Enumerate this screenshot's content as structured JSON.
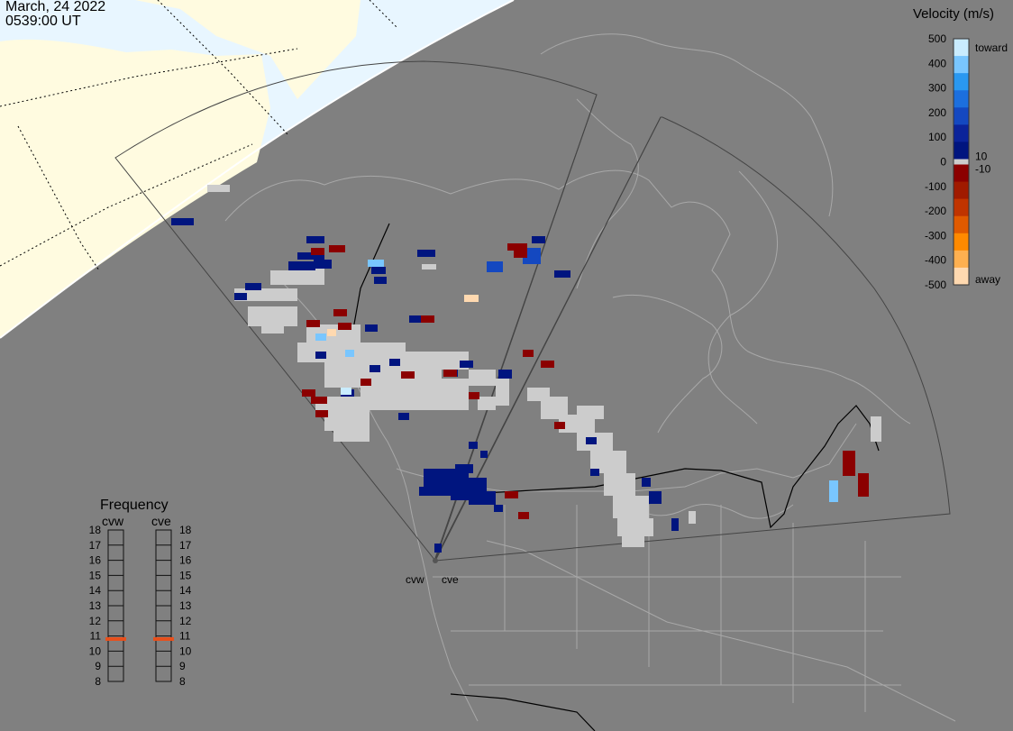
{
  "header": {
    "date": "March, 24 2022",
    "time": "0539:00 UT"
  },
  "velocity_legend": {
    "title": "Velocity (m/s)",
    "ticks": [
      "500",
      "400",
      "300",
      "200",
      "100",
      "0",
      "-100",
      "-200",
      "-300",
      "-400",
      "-500"
    ],
    "near_zero_labels": [
      "10",
      "-10"
    ],
    "toward_label": "toward",
    "away_label": "away",
    "colors_toward": [
      "#c9ecff",
      "#79c6ff",
      "#2a98f0",
      "#1c6fde",
      "#1448c0",
      "#0b239a",
      "#00157f"
    ],
    "colors_away": [
      "#8b0000",
      "#a01a00",
      "#c03400",
      "#e05a00",
      "#ff8a00",
      "#ffb050",
      "#ffd9b0"
    ]
  },
  "frequency_panel": {
    "title": "Frequency",
    "left_label": "cvw",
    "right_label": "cve",
    "scale": [
      "18",
      "17",
      "16",
      "15",
      "14",
      "13",
      "12",
      "11",
      "10",
      "9",
      "8"
    ],
    "cvw_mhz": 10.8,
    "cve_mhz": 10.8,
    "indicator_color": "#e8501c"
  },
  "radars": {
    "west": "cvw",
    "east": "cve"
  },
  "colors": {
    "background": "#808080",
    "land_outline": "#a9a9a9",
    "daylight": "#fffbe0",
    "ocean_day": "#e8f6ff",
    "ground_scatter": "#cccccc"
  }
}
